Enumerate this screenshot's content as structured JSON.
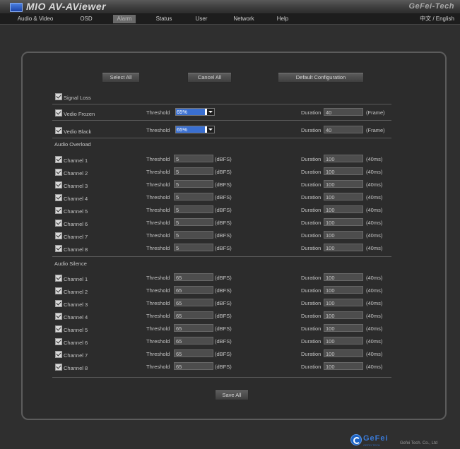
{
  "app": {
    "title": "MIO AV-AViewer",
    "brand_tag": "GeFei-Tech"
  },
  "menu": {
    "items": [
      "Audio & Video",
      "OSD",
      "Alarm",
      "Status",
      "User",
      "Network",
      "Help"
    ],
    "active": "Alarm",
    "language": "中文 / English"
  },
  "buttons": {
    "select_all": "Select All",
    "cancel_all": "Cancel All",
    "default_config": "Default Configuration",
    "save_all": "Save All"
  },
  "labels": {
    "threshold": "Threshold",
    "duration": "Duration",
    "frame_unit": "(Frame)",
    "dbfs_unit": "(dBFS)",
    "ms_unit": "(40ms)"
  },
  "video": {
    "signal_loss": {
      "label": "Signal Loss",
      "checked": true
    },
    "frozen": {
      "label": "Vedio Frozen",
      "threshold": "65%",
      "duration": "40",
      "checked": true
    },
    "black": {
      "label": "Vedio Black",
      "threshold": "65%",
      "duration": "40",
      "checked": true
    }
  },
  "overload": {
    "title": "Audio Overload",
    "channels": [
      {
        "label": "Channel 1",
        "threshold": "5",
        "duration": "100",
        "checked": true
      },
      {
        "label": "Channel 2",
        "threshold": "5",
        "duration": "100",
        "checked": true
      },
      {
        "label": "Channel 3",
        "threshold": "5",
        "duration": "100",
        "checked": true
      },
      {
        "label": "Channel 4",
        "threshold": "5",
        "duration": "100",
        "checked": true
      },
      {
        "label": "Channel 5",
        "threshold": "5",
        "duration": "100",
        "checked": true
      },
      {
        "label": "Channel 6",
        "threshold": "5",
        "duration": "100",
        "checked": true
      },
      {
        "label": "Channel 7",
        "threshold": "5",
        "duration": "100",
        "checked": true
      },
      {
        "label": "Channel 8",
        "threshold": "5",
        "duration": "100",
        "checked": true
      }
    ]
  },
  "silence": {
    "title": "Audio Silence",
    "channels": [
      {
        "label": "Channel 1",
        "threshold": "65",
        "duration": "100",
        "checked": true
      },
      {
        "label": "Channel 2",
        "threshold": "65",
        "duration": "100",
        "checked": true
      },
      {
        "label": "Channel 3",
        "threshold": "65",
        "duration": "100",
        "checked": true
      },
      {
        "label": "Channel 4",
        "threshold": "65",
        "duration": "100",
        "checked": true
      },
      {
        "label": "Channel 5",
        "threshold": "65",
        "duration": "100",
        "checked": true
      },
      {
        "label": "Channel 6",
        "threshold": "65",
        "duration": "100",
        "checked": true
      },
      {
        "label": "Channel 7",
        "threshold": "65",
        "duration": "100",
        "checked": true
      },
      {
        "label": "Channel 8",
        "threshold": "65",
        "duration": "100",
        "checked": true
      }
    ]
  },
  "footer": {
    "brand": "GeFei",
    "brand_sub": "GEFEI TECH",
    "company": "Gefei Tech. Co., Ltd"
  }
}
